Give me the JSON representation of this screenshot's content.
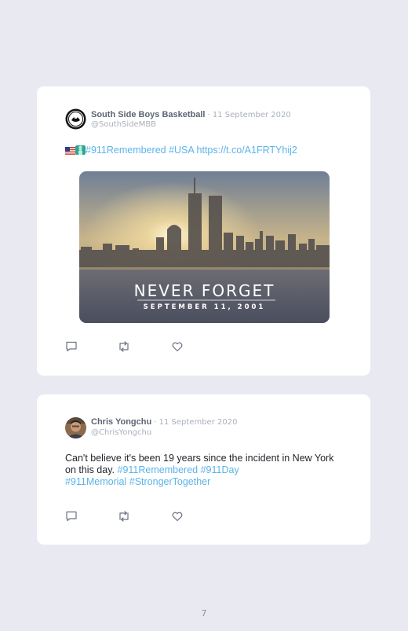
{
  "tweets": [
    {
      "author_name": "South Side Boys Basketball",
      "date": "· 11 September 2020",
      "handle": "@SouthSideMBB",
      "hashtags": "#911Remembered #USA",
      "link": "https://t.co/A1FRTYhij2",
      "emoji": [
        "us-flag-icon",
        "statue-of-liberty-icon"
      ],
      "image": {
        "headline": "NEVER FORGET",
        "subline": "SEPTEMBER 11, 2001"
      }
    },
    {
      "author_name": "Chris Yongchu",
      "date": "· 11 September 2020",
      "handle": "@ChrisYongchu",
      "text": "Can't believe it's been 19 years since the incident in New York on this day.",
      "hashtags_line1": "#911Remembered #911Day",
      "hashtags_line2": "#911Memorial #StrongerTogether"
    }
  ],
  "page_number": "7",
  "colors": {
    "background": "#e9eaf1",
    "card": "#ffffff",
    "hashtag": "#5ab4e8",
    "name": "#5b6573",
    "muted": "#aab0bc"
  },
  "action_icons": [
    "reply-icon",
    "retweet-icon",
    "like-icon"
  ]
}
